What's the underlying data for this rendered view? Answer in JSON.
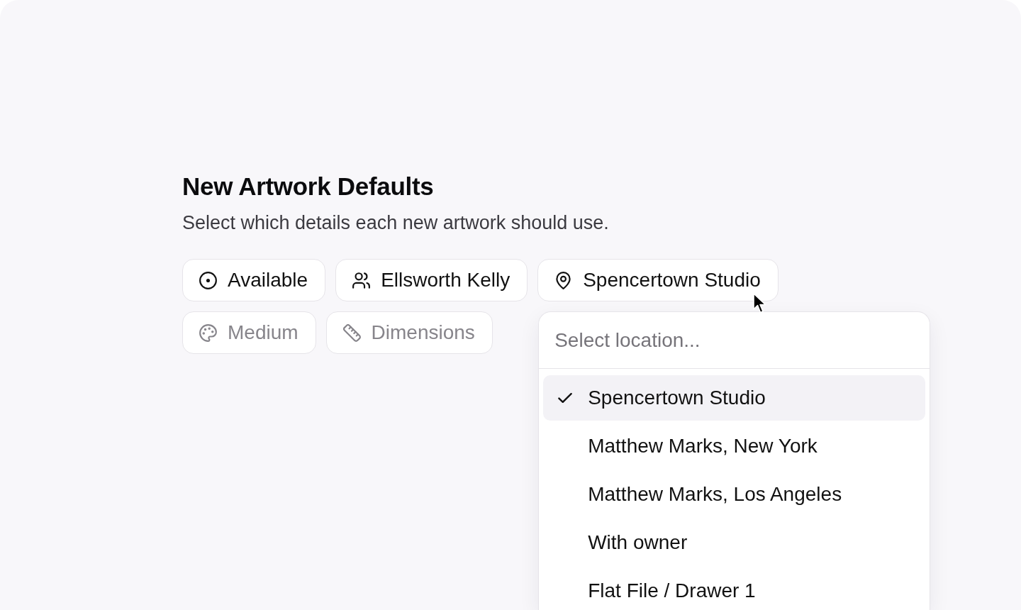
{
  "section": {
    "title": "New Artwork Defaults",
    "description": "Select which details each new artwork should use."
  },
  "chips": [
    {
      "kind": "status",
      "label": "Available",
      "set": true,
      "expanded": false
    },
    {
      "kind": "artist",
      "label": "Ellsworth Kelly",
      "set": true,
      "expanded": false
    },
    {
      "kind": "location",
      "label": "Spencertown Studio",
      "set": true,
      "expanded": true
    },
    {
      "kind": "medium",
      "label": "Medium",
      "set": false,
      "expanded": false
    },
    {
      "kind": "dimensions",
      "label": "Dimensions",
      "set": false,
      "expanded": false
    }
  ],
  "location_menu": {
    "placeholder": "Select location...",
    "options": [
      {
        "label": "Spencertown Studio",
        "selected": true
      },
      {
        "label": "Matthew Marks, New York",
        "selected": false
      },
      {
        "label": "Matthew Marks, Los Angeles",
        "selected": false
      },
      {
        "label": "With owner",
        "selected": false
      },
      {
        "label": "Flat File / Drawer 1",
        "selected": false
      }
    ]
  }
}
